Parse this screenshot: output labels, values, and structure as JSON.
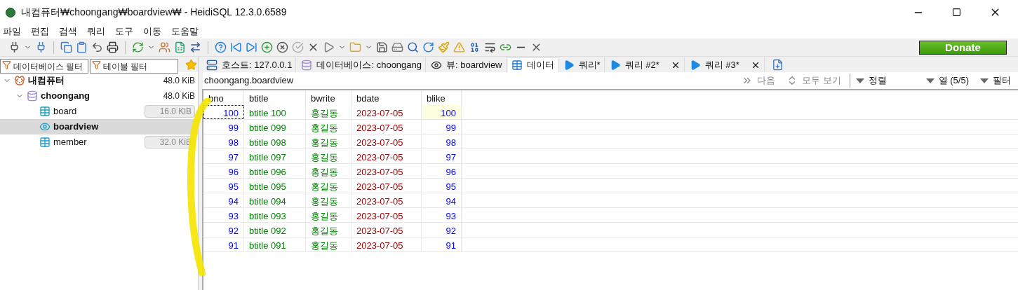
{
  "window": {
    "title": "내컴퓨터₩choongang₩boardview₩ - HeidiSQL 12.3.0.6589"
  },
  "menu": [
    "파일",
    "편집",
    "검색",
    "쿼리",
    "도구",
    "이동",
    "도움말"
  ],
  "donate": "Donate",
  "filters": [
    {
      "placeholder": "데이터베이스 필터"
    },
    {
      "placeholder": "테이블 필터"
    }
  ],
  "tree": [
    {
      "label": "내컴퓨터",
      "kind": "server",
      "size": "48.0 KiB",
      "selected": false,
      "expanded": true,
      "children": [
        {
          "label": "choongang",
          "kind": "database",
          "size": "48.0 KiB",
          "selected": false,
          "expanded": true,
          "children": [
            {
              "label": "board",
              "kind": "table",
              "size": "16.0 KiB",
              "selected": false
            },
            {
              "label": "boardview",
              "kind": "view",
              "selected": true
            },
            {
              "label": "member",
              "kind": "table",
              "size": "32.0 KiB",
              "selected": false
            }
          ]
        }
      ]
    }
  ],
  "tabs": [
    {
      "label": "호스트: 127.0.0.1",
      "kind": "host",
      "selected": false,
      "closable": false
    },
    {
      "label": "데이터베이스: choongang",
      "kind": "database",
      "selected": false,
      "closable": false
    },
    {
      "label": "뷰: boardview",
      "kind": "view",
      "selected": false,
      "closable": false
    },
    {
      "label": "데이터",
      "kind": "data",
      "selected": true,
      "closable": false
    },
    {
      "label": "쿼리*",
      "kind": "query",
      "selected": false,
      "closable": false
    },
    {
      "label": "쿼리 #2*",
      "kind": "query",
      "selected": false,
      "closable": true
    },
    {
      "label": "쿼리 #3*",
      "kind": "query",
      "selected": false,
      "closable": true
    }
  ],
  "breadcrumb": "choongang.boardview",
  "grid_toolbar": [
    {
      "label": "다음",
      "kind": "next",
      "disabled": true
    },
    {
      "label": "모두 보기",
      "kind": "showall",
      "disabled": true
    },
    {
      "label": "정렬",
      "kind": "dropdown",
      "disabled": false
    },
    {
      "label": "열 (5/5)",
      "kind": "dropdown",
      "disabled": false
    },
    {
      "label": "필터",
      "kind": "dropdown",
      "disabled": false
    }
  ],
  "table": {
    "columns": [
      "bno",
      "btitle",
      "bwrite",
      "bdate",
      "blike"
    ],
    "rows": [
      {
        "cells": [
          "100",
          "btitle 100",
          "홍길동",
          "2023-07-05",
          "100"
        ],
        "selected": true
      },
      {
        "cells": [
          "99",
          "btitle 099",
          "홍길동",
          "2023-07-05",
          "99"
        ],
        "selected": false
      },
      {
        "cells": [
          "98",
          "btitle 098",
          "홍길동",
          "2023-07-05",
          "98"
        ],
        "selected": false
      },
      {
        "cells": [
          "97",
          "btitle 097",
          "홍길동",
          "2023-07-05",
          "97"
        ],
        "selected": false
      },
      {
        "cells": [
          "96",
          "btitle 096",
          "홍길동",
          "2023-07-05",
          "96"
        ],
        "selected": false
      },
      {
        "cells": [
          "95",
          "btitle 095",
          "홍길동",
          "2023-07-05",
          "95"
        ],
        "selected": false
      },
      {
        "cells": [
          "94",
          "btitle 094",
          "홍길동",
          "2023-07-05",
          "94"
        ],
        "selected": false
      },
      {
        "cells": [
          "93",
          "btitle 093",
          "홍길동",
          "2023-07-05",
          "93"
        ],
        "selected": false
      },
      {
        "cells": [
          "92",
          "btitle 092",
          "홍길동",
          "2023-07-05",
          "92"
        ],
        "selected": false
      },
      {
        "cells": [
          "91",
          "btitle 091",
          "홍길동",
          "2023-07-05",
          "91"
        ],
        "selected": false
      }
    ]
  }
}
